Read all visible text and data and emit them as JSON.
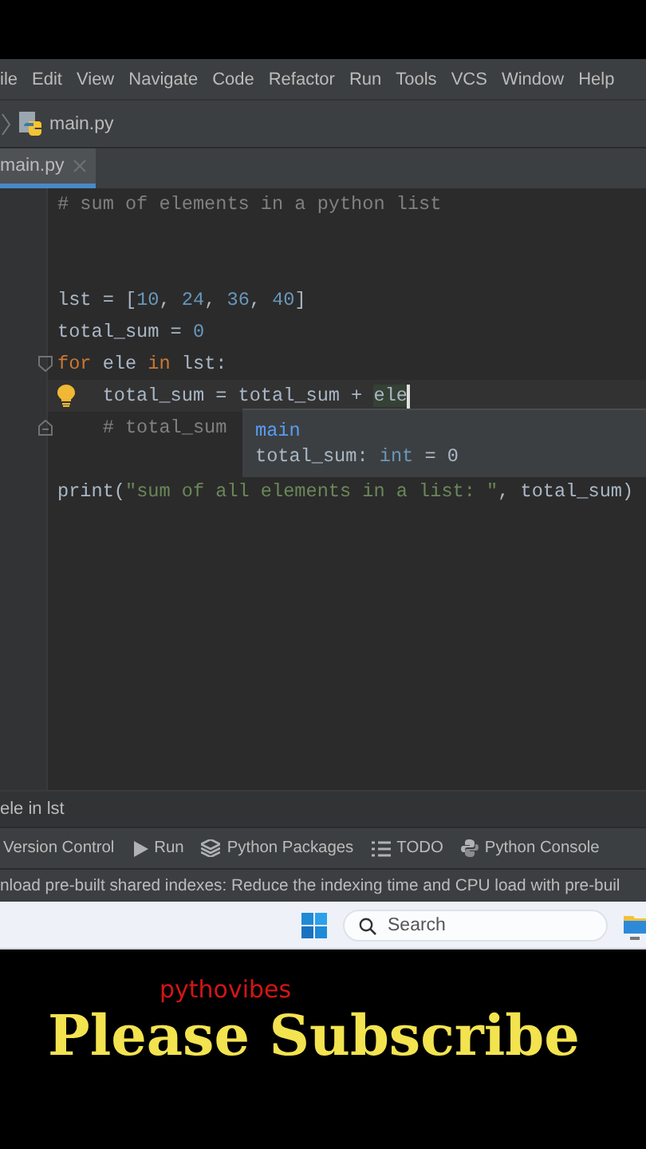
{
  "menu": [
    "ile",
    "Edit",
    "View",
    "Navigate",
    "Code",
    "Refactor",
    "Run",
    "Tools",
    "VCS",
    "Window",
    "Help"
  ],
  "breadcrumb": {
    "file": "main.py"
  },
  "tabs": [
    {
      "label": "main.py",
      "selected": true
    }
  ],
  "editor": {
    "lines": [
      {
        "kind": "code",
        "tokens": [
          {
            "kind": "comment",
            "text": "# sum of elements in a python list"
          }
        ]
      },
      {
        "kind": "blank"
      },
      {
        "kind": "blank"
      },
      {
        "kind": "code",
        "tokens": [
          {
            "kind": "plain",
            "text": "lst = ["
          },
          {
            "kind": "number",
            "text": "10"
          },
          {
            "kind": "plain",
            "text": ", "
          },
          {
            "kind": "number",
            "text": "24"
          },
          {
            "kind": "plain",
            "text": ", "
          },
          {
            "kind": "number",
            "text": "36"
          },
          {
            "kind": "plain",
            "text": ", "
          },
          {
            "kind": "number",
            "text": "40"
          },
          {
            "kind": "plain",
            "text": "]"
          }
        ]
      },
      {
        "kind": "code",
        "tokens": [
          {
            "kind": "plain",
            "text": "total_sum = "
          },
          {
            "kind": "number",
            "text": "0"
          }
        ]
      },
      {
        "kind": "block-start",
        "tokens": [
          {
            "kind": "keyword",
            "text": "for"
          },
          {
            "kind": "plain",
            "text": " ele "
          },
          {
            "kind": "keyword",
            "text": "in"
          },
          {
            "kind": "plain",
            "text": " lst:"
          }
        ]
      },
      {
        "kind": "cursor-line",
        "tokens": [
          {
            "kind": "plain",
            "text": "    total_sum = total_sum + "
          },
          {
            "kind": "usage",
            "text": "ele"
          }
        ]
      },
      {
        "kind": "block-end",
        "tokens": [
          {
            "kind": "comment",
            "text": "    # total_sum"
          }
        ]
      },
      {
        "kind": "blank"
      },
      {
        "kind": "code",
        "tokens": [
          {
            "kind": "plain",
            "text": "print("
          },
          {
            "kind": "string",
            "text": "\"sum of all elements in a list: \""
          },
          {
            "kind": "plain",
            "text": ", total_sum)"
          }
        ]
      }
    ],
    "popup": {
      "title": "main",
      "tokens": [
        {
          "kind": "plain",
          "text": "total_sum: "
        },
        {
          "kind": "builtin",
          "text": "int"
        },
        {
          "kind": "plain",
          "text": " = 0"
        }
      ]
    },
    "path": "ele in lst"
  },
  "tool_windows": [
    {
      "label": "Version Control",
      "kind": "plain"
    },
    {
      "label": "Run",
      "kind": "run"
    },
    {
      "label": "Python Packages",
      "kind": "packages"
    },
    {
      "label": "TODO",
      "kind": "todo"
    },
    {
      "label": "Python Console",
      "kind": "console"
    }
  ],
  "notification": "nload pre-built shared indexes: Reduce the indexing time and CPU load with pre-buil",
  "taskbar": {
    "search": {
      "placeholder": "Search"
    }
  },
  "banner": {
    "channel": "pythovibes",
    "title": "Please Subscribe"
  }
}
